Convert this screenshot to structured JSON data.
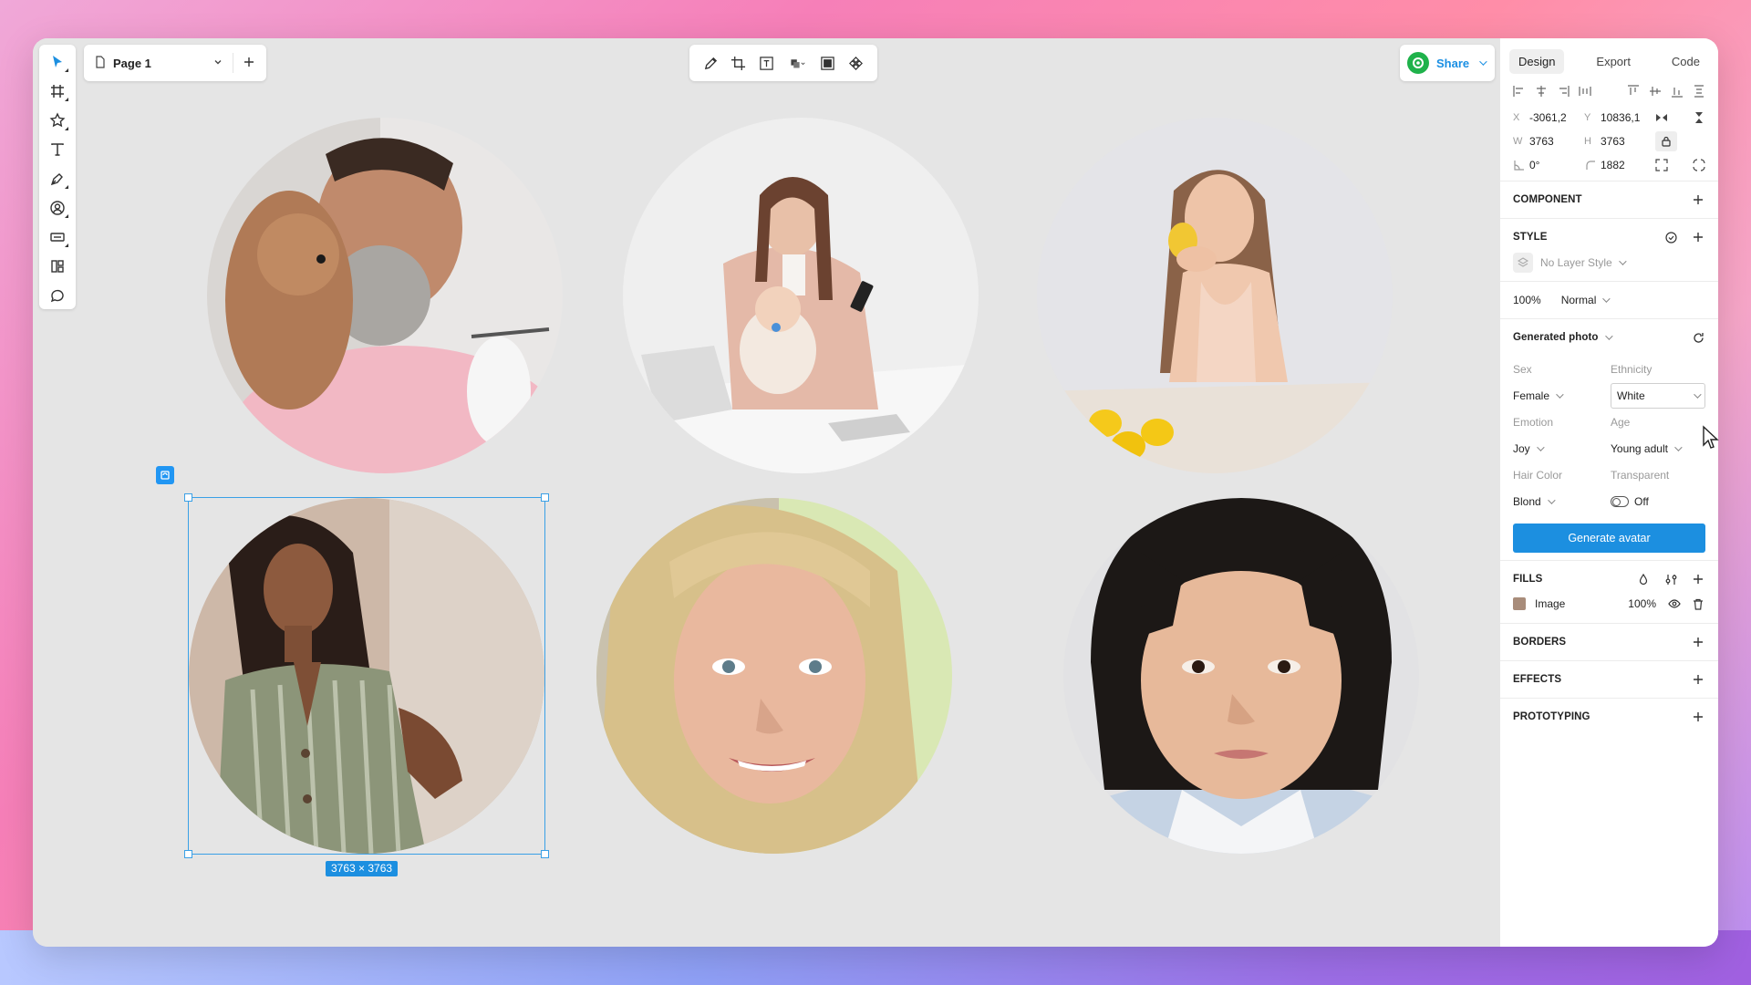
{
  "page": {
    "name": "Page 1"
  },
  "share": {
    "label": "Share"
  },
  "selection": {
    "size": "3763 × 3763"
  },
  "panel": {
    "tabs": [
      "Design",
      "Export",
      "Code"
    ],
    "x_label": "X",
    "x_value": "-3061,2",
    "y_label": "Y",
    "y_value": "10836,1",
    "w_label": "W",
    "w_value": "3763",
    "h_label": "H",
    "h_value": "3763",
    "rotation": "0°",
    "radius": "1882",
    "component_title": "COMPONENT",
    "style_title": "STYLE",
    "layer_style": "No Layer Style",
    "opacity": "100%",
    "blend": "Normal",
    "generated_title": "Generated photo",
    "sex_label": "Sex",
    "sex_value": "Female",
    "ethnicity_label": "Ethnicity",
    "ethnicity_value": "White",
    "emotion_label": "Emotion",
    "emotion_value": "Joy",
    "age_label": "Age",
    "age_value": "Young adult",
    "hair_label": "Hair Color",
    "hair_value": "Blond",
    "transparent_label": "Transparent",
    "transparent_value": "Off",
    "generate_button": "Generate avatar",
    "fills_title": "FILLS",
    "fill_name": "Image",
    "fill_opacity": "100%",
    "borders_title": "BORDERS",
    "effects_title": "EFFECTS",
    "prototyping_title": "PROTOTYPING"
  },
  "icons": {
    "left_tools": [
      "move-icon",
      "frame-icon",
      "star-icon",
      "text-icon",
      "pen-icon",
      "avatar-icon",
      "component-icon",
      "plugin-icon",
      "comment-icon"
    ],
    "center_tools": [
      "pencil-icon",
      "crop-icon",
      "text-box-icon",
      "boolean-icon",
      "mask-icon",
      "component-diamond-icon"
    ]
  },
  "colors": {
    "accent": "#1c8fe0",
    "canvas": "#e5e5e5",
    "share_logo": "#1fb24b"
  }
}
